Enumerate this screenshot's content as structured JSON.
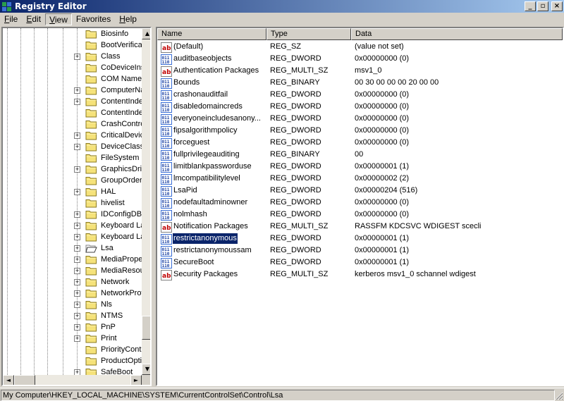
{
  "window": {
    "title": "Registry Editor",
    "buttons": {
      "minimize": "_",
      "maximize": "□",
      "close": "×"
    }
  },
  "menu": [
    {
      "label": "File",
      "key": "F",
      "rest": "ile"
    },
    {
      "label": "Edit",
      "key": "E",
      "rest": "dit"
    },
    {
      "label": "View",
      "key": "V",
      "rest": "iew"
    },
    {
      "label": "Favorites",
      "key": "",
      "rest": "Favorites"
    },
    {
      "label": "Help",
      "key": "H",
      "rest": "elp"
    }
  ],
  "tree": {
    "items": [
      {
        "label": "Biosinfo",
        "expandable": false
      },
      {
        "label": "BootVerificat",
        "expandable": false
      },
      {
        "label": "Class",
        "expandable": true
      },
      {
        "label": "CoDeviceInst",
        "expandable": false
      },
      {
        "label": "COM Name A",
        "expandable": false
      },
      {
        "label": "ComputerNa",
        "expandable": true
      },
      {
        "label": "ContentInde",
        "expandable": true
      },
      {
        "label": "ContentInde",
        "expandable": false
      },
      {
        "label": "CrashContro",
        "expandable": false
      },
      {
        "label": "CriticalDevic",
        "expandable": true
      },
      {
        "label": "DeviceClasse",
        "expandable": true
      },
      {
        "label": "FileSystem",
        "expandable": false
      },
      {
        "label": "GraphicsDriv",
        "expandable": true
      },
      {
        "label": "GroupOrderl",
        "expandable": false
      },
      {
        "label": "HAL",
        "expandable": true
      },
      {
        "label": "hivelist",
        "expandable": false
      },
      {
        "label": "IDConfigDB",
        "expandable": true
      },
      {
        "label": "Keyboard La",
        "expandable": true
      },
      {
        "label": "Keyboard La",
        "expandable": true
      },
      {
        "label": "Lsa",
        "expandable": true,
        "open": true
      },
      {
        "label": "MediaProper",
        "expandable": true
      },
      {
        "label": "MediaResou",
        "expandable": true
      },
      {
        "label": "Network",
        "expandable": true
      },
      {
        "label": "NetworkProv",
        "expandable": true
      },
      {
        "label": "Nls",
        "expandable": true
      },
      {
        "label": "NTMS",
        "expandable": true
      },
      {
        "label": "PnP",
        "expandable": true
      },
      {
        "label": "Print",
        "expandable": true
      },
      {
        "label": "PriorityContr",
        "expandable": false
      },
      {
        "label": "ProductOptio",
        "expandable": false
      },
      {
        "label": "SafeBoot",
        "expandable": true
      }
    ]
  },
  "list": {
    "columns": [
      "Name",
      "Type",
      "Data"
    ],
    "rows": [
      {
        "icon": "string",
        "name": "(Default)",
        "type": "REG_SZ",
        "data": "(value not set)"
      },
      {
        "icon": "binary",
        "name": "auditbaseobjects",
        "type": "REG_DWORD",
        "data": "0x00000000 (0)"
      },
      {
        "icon": "string",
        "name": "Authentication Packages",
        "type": "REG_MULTI_SZ",
        "data": "msv1_0"
      },
      {
        "icon": "binary",
        "name": "Bounds",
        "type": "REG_BINARY",
        "data": "00 30 00 00 00 20 00 00"
      },
      {
        "icon": "binary",
        "name": "crashonauditfail",
        "type": "REG_DWORD",
        "data": "0x00000000 (0)"
      },
      {
        "icon": "binary",
        "name": "disabledomaincreds",
        "type": "REG_DWORD",
        "data": "0x00000000 (0)"
      },
      {
        "icon": "binary",
        "name": "everyoneincludesanony...",
        "type": "REG_DWORD",
        "data": "0x00000000 (0)"
      },
      {
        "icon": "binary",
        "name": "fipsalgorithmpolicy",
        "type": "REG_DWORD",
        "data": "0x00000000 (0)"
      },
      {
        "icon": "binary",
        "name": "forceguest",
        "type": "REG_DWORD",
        "data": "0x00000000 (0)"
      },
      {
        "icon": "binary",
        "name": "fullprivilegeauditing",
        "type": "REG_BINARY",
        "data": "00"
      },
      {
        "icon": "binary",
        "name": "limitblankpassworduse",
        "type": "REG_DWORD",
        "data": "0x00000001 (1)"
      },
      {
        "icon": "binary",
        "name": "lmcompatibilitylevel",
        "type": "REG_DWORD",
        "data": "0x00000002 (2)"
      },
      {
        "icon": "binary",
        "name": "LsaPid",
        "type": "REG_DWORD",
        "data": "0x00000204 (516)"
      },
      {
        "icon": "binary",
        "name": "nodefaultadminowner",
        "type": "REG_DWORD",
        "data": "0x00000000 (0)"
      },
      {
        "icon": "binary",
        "name": "nolmhash",
        "type": "REG_DWORD",
        "data": "0x00000000 (0)"
      },
      {
        "icon": "string",
        "name": "Notification Packages",
        "type": "REG_MULTI_SZ",
        "data": "RASSFM KDCSVC WDIGEST scecli"
      },
      {
        "icon": "binary",
        "name": "restrictanonymous",
        "type": "REG_DWORD",
        "data": "0x00000001 (1)",
        "selected": true
      },
      {
        "icon": "binary",
        "name": "restrictanonymoussam",
        "type": "REG_DWORD",
        "data": "0x00000001 (1)"
      },
      {
        "icon": "binary",
        "name": "SecureBoot",
        "type": "REG_DWORD",
        "data": "0x00000001 (1)"
      },
      {
        "icon": "string",
        "name": "Security Packages",
        "type": "REG_MULTI_SZ",
        "data": "kerberos msv1_0 schannel wdigest"
      }
    ]
  },
  "status": {
    "path": "My Computer\\HKEY_LOCAL_MACHINE\\SYSTEM\\CurrentControlSet\\Control\\Lsa"
  }
}
